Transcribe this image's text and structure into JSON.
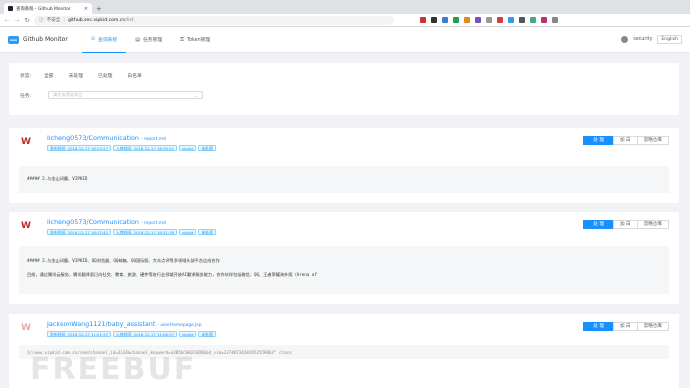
{
  "browser": {
    "tab_title": "查询系统 - Github Monitor",
    "tab_close": "×",
    "new_tab": "+",
    "insecure": "不安全",
    "host": "github.sec.vipkid.com.cn",
    "path": "/list",
    "nav_back": "←",
    "nav_forward": "→",
    "nav_reload": "↻",
    "info_icon": "ⓘ",
    "ext_colors": [
      "#cc3333",
      "#333333",
      "#3b7bd8",
      "#2a9d4a",
      "#e28a1b",
      "#7b4cc2",
      "#999999",
      "#d43f3a",
      "#2d9bf0",
      "#555555",
      "#44aa88",
      "#bb3377",
      "#888888"
    ]
  },
  "header": {
    "logo_text": "mon",
    "brand": "Github Monitor",
    "menu": [
      {
        "label": "查询系统",
        "icon": "⊙"
      },
      {
        "label": "任务管理",
        "icon": "▤"
      },
      {
        "label": "Token管理",
        "icon": "⚿"
      }
    ],
    "user": "security",
    "lang": "English"
  },
  "filter": {
    "status_label": "状态:",
    "status_options": [
      "全部",
      "未处理",
      "已处理",
      "白名单"
    ],
    "task_label": "任务:",
    "task_placeholder": "请任务筛选条目",
    "task_chevron": "⌄"
  },
  "actions": {
    "process": "处 理",
    "whitelist": "加 白",
    "ignore": "忽略仓库"
  },
  "results": [
    {
      "repo": "licheng0573/Communication",
      "file": "report.md",
      "tags": [
        "发布时间: 2018-12-17 16:23:27",
        "入库时间: 2018-12-17 16:26:52",
        "vipkid",
        "未处理"
      ],
      "lines": [
        "##### 2.与金山词霸、VIPKID"
      ]
    },
    {
      "repo": "licheng0573/Communication",
      "file": "report.md",
      "tags": [
        "发布时间: 2018-12-17 16:17:42",
        "入库时间: 2018-12-17 16:21:38",
        "vipkid",
        "未处理"
      ],
      "lines": [
        "##### 2.与金山词霸、VIPKID、QQ浏览器、QQ邮箱、QQ国际版、大众点评等多领域头部平台达成合作",
        "目前，通过腾讯云服务，腾讯翻译君已向社交、教育、旅游、硬件等各行业领域开放AI翻译服务能力，合作伙伴包括微信、QQ、王者荣耀海外版（Arena of"
      ]
    },
    {
      "repo": "JacksonWang1121/baby_assistant",
      "file": "userHomepage.jsp",
      "tags": [
        "发布时间: 2018-12-17 11:01:37",
        "入库时间: 2018-12-17 11:06:37",
        "vipkid",
        "未处理"
      ],
      "lines": [
        "1//www.vipkid.com.cn/sem?channel_id=3126&channel_keyword=a3B5bC00232DD&bd_vid=13748734201952559862\" class"
      ]
    }
  ],
  "watermark": "FREEBUF"
}
